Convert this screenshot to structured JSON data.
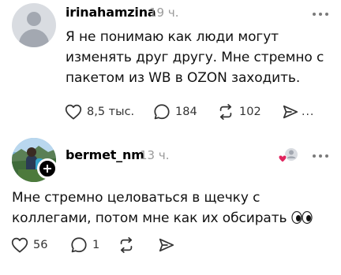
{
  "posts": [
    {
      "username": "irinahamzina",
      "time": "19 ч.",
      "text_lines": [
        "Я не понимаю как люди могут",
        "изменять друг другу. Мне стремно с",
        "пакетом из WB в OZON заходить."
      ],
      "likes": "8,5 тыс.",
      "comments": "184",
      "reposts": "102",
      "share_more": "..."
    },
    {
      "username": "bermet_nm",
      "time": "13 ч.",
      "text_lines": [
        "Мне стремно целоваться в щечку с",
        "коллегами, потом мне как их обсирать"
      ],
      "likes": "56",
      "comments": "1"
    }
  ],
  "colors": {
    "text": "#000000",
    "muted": "#9a9a9a",
    "icon": "#333333",
    "like_heart": "#e0245e"
  },
  "icons": {
    "more": "ellipsis-icon",
    "like": "heart-icon",
    "comment": "speech-bubble-icon",
    "repost": "repost-arrows-icon",
    "share": "send-icon",
    "follow": "plus-icon",
    "emoji": "eyes-emoji"
  }
}
